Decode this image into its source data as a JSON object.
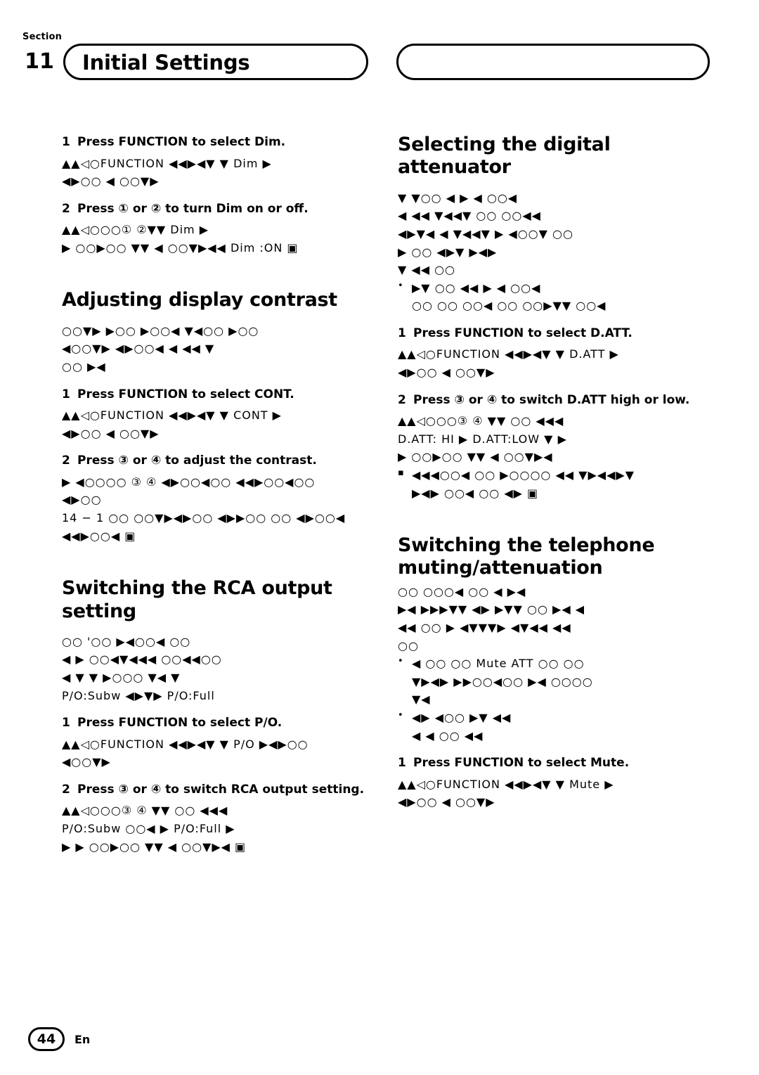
{
  "header": {
    "section_word": "Section",
    "section_number": "11",
    "title": "Initial Settings"
  },
  "footer": {
    "page_number": "44",
    "language": "En"
  },
  "left_column": {
    "blocks": [
      {
        "type": "step",
        "number": "1",
        "text": "Press FUNCTION to select Dim."
      },
      {
        "type": "glyph",
        "lines": [
          "▲▲◁○FUNCTION ◀◀▶◀▼ ▼       Dim ▶",
          "◀▶○○ ◀ ○○▼▶"
        ]
      },
      {
        "type": "step",
        "number": "2",
        "text": "Press ① or ② to turn Dim on or off."
      },
      {
        "type": "glyph",
        "lines": [
          "▲▲◁○○○① ②▼▼     Dim  ▶",
          "▶ ○○▶○○ ▼▼ ◀ ○○▼▶◀◀      Dim :ON ▣"
        ]
      },
      {
        "type": "heading",
        "text": "Adjusting display contrast"
      },
      {
        "type": "glyph",
        "lines": [
          "○○▼▶ ▶○○ ▶○○◀ ▼◀○○ ▶○○",
          "◀○○▼▶ ◀▶○○◀ ◀ ◀◀ ▼",
          "○○ ▶◀"
        ]
      },
      {
        "type": "step",
        "number": "1",
        "text": "Press FUNCTION to select CONT."
      },
      {
        "type": "glyph",
        "lines": [
          "▲▲◁○FUNCTION ◀◀▶◀▼ ▼     CONT ▶",
          "◀▶○○ ◀ ○○▼▶"
        ]
      },
      {
        "type": "step",
        "number": "2",
        "text": "Press ③ or ④ to adjust the contrast."
      },
      {
        "type": "glyph",
        "lines": [
          "▶ ◀○○○○    ③   ④ ◀▶○○◀○○  ◀◀▶○○◀○○",
          "◀▶○○",
          "14 − 1 ○○ ○○▼▶◀▶○○ ◀▶▶○○ ○○ ◀▶○○◀",
          "◀◀▶○○◀  ▣"
        ]
      },
      {
        "type": "heading",
        "text": "Switching the RCA output setting"
      },
      {
        "type": "glyph",
        "lines": [
          "○○     '○○ ▶◀○○◀ ○○",
          "◀ ▶ ○○◀▼◀◀◀ ○○◀◀○○",
          "◀ ▼ ▼ ▶○○○ ▼◀ ▼",
          "P/O:Subw ◀▶▼▶      P/O:Full"
        ]
      },
      {
        "type": "step",
        "number": "1",
        "text": "Press FUNCTION to select P/O."
      },
      {
        "type": "glyph",
        "lines": [
          "▲▲◁○FUNCTION ◀◀▶◀▼ ▼     P/O ▶◀▶○○",
          "◀○○▼▶"
        ]
      },
      {
        "type": "step",
        "number": "2",
        "text": "Press ③ or ④ to switch RCA output setting."
      },
      {
        "type": "glyph",
        "lines": [
          "▲▲◁○○○③   ④ ▼▼ ○○ ◀◀◀",
          "P/O:Subw ○○◀ ▶       P/O:Full ▶",
          "▶ ▶ ○○▶○○ ▼▼ ◀ ○○▼▶◀      ▣"
        ]
      }
    ]
  },
  "right_column": {
    "blocks": [
      {
        "type": "heading",
        "text": "Selecting the digital attenuator"
      },
      {
        "type": "glyph",
        "lines": [
          "▼ ▼○○ ◀ ▶  ◀ ○○◀",
          "◀ ◀◀ ▼◀◀▼ ○○  ○○◀◀",
          "◀▶▼◀ ◀ ▼◀◀▼  ▶ ◀○○▼  ○○",
          "▶ ○○ ◀▶▼ ▶◀▶",
          "▼  ◀◀ ○○"
        ]
      },
      {
        "type": "bullet",
        "lines": [
          "▶▼ ○○ ◀◀ ▶ ◀  ○○◀",
          "○○ ○○ ○○◀ ○○ ○○▶▼▼ ○○◀"
        ]
      },
      {
        "type": "step",
        "number": "1",
        "text": "Press FUNCTION to select D.ATT."
      },
      {
        "type": "glyph",
        "lines": [
          "▲▲◁○FUNCTION ◀◀▶◀▼ ▼      D.ATT ▶",
          "◀▶○○  ◀ ○○▼▶"
        ]
      },
      {
        "type": "step",
        "number": "2",
        "text": "Press ③ or ④ to switch D.ATT high or low."
      },
      {
        "type": "glyph",
        "lines": [
          "▲▲◁○○○③   ④ ▼▼ ○○ ◀◀◀",
          "D.ATT: HI ▶             D.ATT:LOW ▼ ▶",
          "▶ ○○▶○○ ▼▼ ◀ ○○▼▶◀"
        ]
      },
      {
        "type": "bullet-square",
        "lines": [
          "◀◀◀○○◀ ○○ ▶○○○○ ◀◀ ▼▶◀◀▶▼",
          "▶◀▶ ○○◀ ○○ ◀▶                      ▣"
        ]
      },
      {
        "type": "heading",
        "text": "Switching the telephone muting/attenuation"
      },
      {
        "type": "glyph",
        "lines": [
          "○○ ○○○◀ ○○ ◀ ▶◀",
          "▶◀ ▶▶▶▼▼ ◀▶ ▶▼▼ ○○ ▶◀ ◀",
          "◀◀ ○○ ▶ ◀▼▼▼▶ ◀▼◀◀ ◀◀",
          "○○"
        ]
      },
      {
        "type": "bullet",
        "lines": [
          "◀ ○○ ○○              Mute   ATT ○○ ○○",
          "▼▶◀▶ ▶▶○○◀○○ ▶◀ ○○○○",
          "▼◀"
        ]
      },
      {
        "type": "bullet",
        "lines": [
          "◀▶ ◀○○ ▶▼ ◀◀",
          "◀ ◀ ○○ ◀◀"
        ]
      },
      {
        "type": "step",
        "number": "1",
        "text": "Press FUNCTION to select Mute."
      },
      {
        "type": "glyph",
        "lines": [
          "▲▲◁○FUNCTION ◀◀▶◀▼ ▼     Mute ▶",
          "◀▶○○  ◀ ○○▼▶"
        ]
      }
    ]
  }
}
